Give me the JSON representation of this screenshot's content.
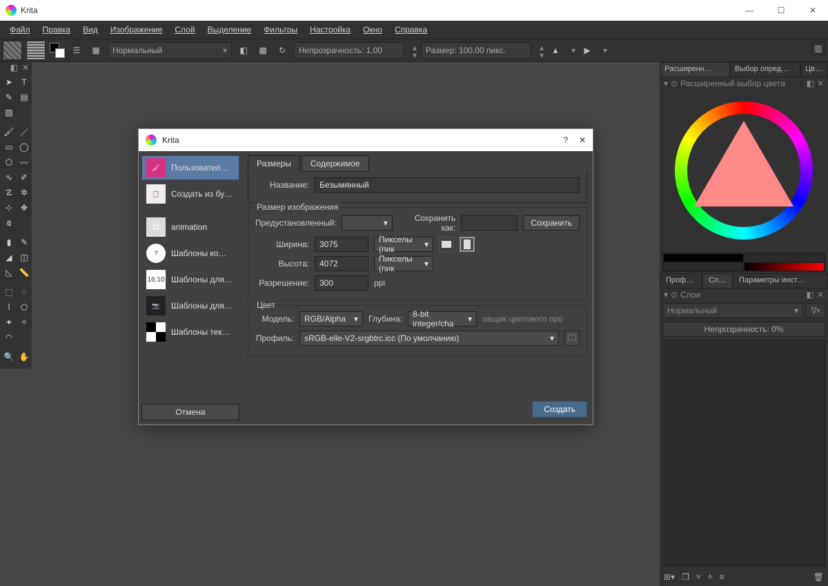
{
  "app": {
    "title": "Krita"
  },
  "window_buttons": {
    "min": "—",
    "max": "☐",
    "close": "✕"
  },
  "menu": [
    "Файл",
    "Правка",
    "Вид",
    "Изображение",
    "Слой",
    "Выделение",
    "Фильтры",
    "Настройка",
    "Окно",
    "Справка"
  ],
  "toolbar": {
    "blend_mode": "Нормальный",
    "opacity_label": "Непрозрачность:  1,00",
    "size_label": "Размер:  100,00 пикс."
  },
  "color_tabs": [
    "Расширенн…",
    "Выбор опред…",
    "Цв…"
  ],
  "color_panel_title": "Расширенный выбор цвета",
  "right_tabs2": [
    "Профил…",
    "Сл…",
    "Параметры инст…"
  ],
  "layers": {
    "panel_title": "Слои",
    "blend": "Нормальный",
    "opacity": "Непрозрачность:  0%"
  },
  "dialog": {
    "title": "Krita",
    "templates": [
      {
        "label": "Пользовател…",
        "active": true,
        "icon": "brush"
      },
      {
        "label": "Создать из бу…",
        "icon": "clipboard"
      },
      {
        "label": "animation",
        "icon": "film"
      },
      {
        "label": "Шаблоны ко…",
        "icon": "comic"
      },
      {
        "label": "Шаблоны для…",
        "icon": "16:10"
      },
      {
        "label": "Шаблоны для…",
        "icon": "camera"
      },
      {
        "label": "Шаблоны тек…",
        "icon": "checker"
      }
    ],
    "cancel": "Отмена",
    "tabs": [
      "Размеры",
      "Содержимое"
    ],
    "name_label": "Название:",
    "name_value": "Безымянный",
    "size_legend": "Размер изображения",
    "preset_label": "Предустановленный:",
    "saveas_label": "Сохранить как:",
    "save_btn": "Сохранить",
    "width_label": "Ширина:",
    "width_value": "3075",
    "height_label": "Высота:",
    "height_value": "4072",
    "res_label": "Разрешение:",
    "res_value": "300",
    "res_unit": "ppi",
    "px_unit": "Пикселы (пик",
    "color_legend": "Цвет",
    "model_label": "Модель:",
    "model_value": "RGB/Alpha",
    "depth_label": "Глубина:",
    "depth_value": "8-bit integer/cha",
    "render_hint": "овщик цветового про",
    "profile_label": "Профиль:",
    "profile_value": "sRGB-elle-V2-srgbtrc.icc (По умолчанию)",
    "create": "Создать"
  }
}
